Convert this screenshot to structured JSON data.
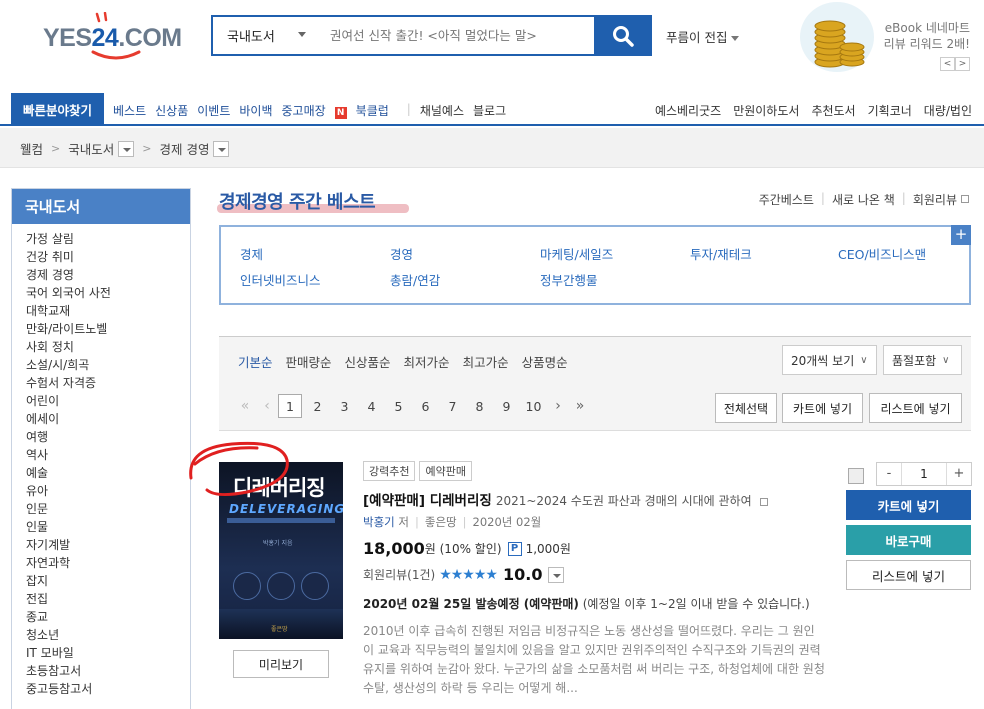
{
  "header": {
    "logo_text_a": "YES",
    "logo_text_b": "24",
    "logo_text_c": ".COM",
    "search": {
      "category": "국내도서",
      "placeholder": "권여선 신작 출간! <아직 멀었다는 말>"
    },
    "person_pick": "푸름이 전집",
    "ebook_banner": {
      "line1": "eBook 네네마트",
      "line2": "리뷰 리워드 2배!",
      "prev": "<",
      "next": ">"
    }
  },
  "nav": {
    "quick_find": "빠른분야찾기",
    "left": [
      "베스트",
      "신상품",
      "이벤트",
      "바이백",
      "중고매장"
    ],
    "bookclub_badge": "N",
    "bookclub": "북클럽",
    "left2": [
      "채널예스",
      "블로그"
    ],
    "right": [
      "예스베리굿즈",
      "만원이하도서",
      "추천도서",
      "기획코너",
      "대량/법인"
    ]
  },
  "breadcrumb": [
    "웰컴",
    "국내도서",
    "경제 경영"
  ],
  "sidebar": {
    "title": "국내도서",
    "items": [
      "가정 살림",
      "건강 취미",
      "경제 경영",
      "국어 외국어 사전",
      "대학교재",
      "만화/라이트노벨",
      "사회 정치",
      "소설/시/희곡",
      "수험서 자격증",
      "어린이",
      "에세이",
      "여행",
      "역사",
      "예술",
      "유아",
      "인문",
      "인물",
      "자기계발",
      "자연과학",
      "잡지",
      "전집",
      "종교",
      "청소년",
      "IT 모바일",
      "초등참고서",
      "중고등참고서"
    ]
  },
  "main": {
    "title": "경제경영 주간 베스트",
    "title_links": [
      "주간베스트",
      "새로 나온 책",
      "회원리뷰"
    ],
    "categories": [
      "경제",
      "경영",
      "마케팅/세일즈",
      "투자/재테크",
      "CEO/비즈니스맨",
      "인터넷비즈니스",
      "총람/연감",
      "정부간행물"
    ],
    "plus": "+",
    "sorts": [
      "기본순",
      "판매량순",
      "신상품순",
      "최저가순",
      "최고가순",
      "상품명순"
    ],
    "per_page": "20개씩 보기",
    "include_soldout": "품절포함",
    "pages": [
      "1",
      "2",
      "3",
      "4",
      "5",
      "6",
      "7",
      "8",
      "9",
      "10"
    ],
    "select_all": "전체선택",
    "cart_add": "카트에 넣기",
    "list_add": "리스트에 넣기"
  },
  "product": {
    "cover_title": "디레버리징",
    "cover_subtitle": "DELEVERAGING",
    "cover_author": "박홍기 지음",
    "cover_publisher": "좋은땅",
    "preview": "미리보기",
    "tags": [
      "강력추천",
      "예약판매"
    ],
    "title": "[예약판매] 디레버리징",
    "subtitle": "2021~2024 수도권 파산과 경매의 시대에 관하여",
    "author": "박홍기",
    "author_suffix": "저",
    "publisher": "좋은땅",
    "date": "2020년 02월",
    "price": "18,000",
    "price_unit": "원",
    "discount": "(10% 할인)",
    "point_badge": "P",
    "points": "1,000원",
    "review_label": "회원리뷰(1건)",
    "stars": "★★★★★",
    "rating": "10.0",
    "ship_bold": "2020년 02월 25일 발송예정 (예약판매)",
    "ship_note": "(예정일 이후 1~2일 이내 받을 수 있습니다.)",
    "description": "2010년 이후 급속히 진행된 저임금 비정규직은 노동 생산성을 떨어뜨렸다. 우리는 그 원인이 교육과 직무능력의 불일치에 있음을 알고 있지만 권위주의적인 수직구조와 기득권의 권력 유지를 위하여 눈감아 왔다. 누군가의 삶을 소모품처럼 써 버리는 구조, 하청업체에 대한 원청 수탈, 생산성의 하락 등 우리는 어떻게 해...",
    "qty_minus": "-",
    "qty": "1",
    "qty_plus": "+",
    "btn_cart": "카트에 넣기",
    "btn_buy": "바로구매",
    "btn_list": "리스트에 넣기"
  },
  "colors": {
    "brand_blue": "#1f5fae",
    "teal": "#2a9fa8",
    "star_blue": "#2d7fd1",
    "highlight_red": "#e8a2a9"
  }
}
